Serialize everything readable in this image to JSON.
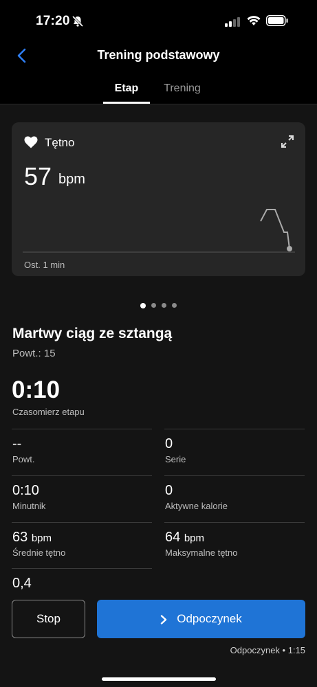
{
  "status_bar": {
    "time": "17:20",
    "icons": [
      "bell-slash-icon",
      "signal-icon",
      "wifi-icon",
      "battery-icon"
    ]
  },
  "nav": {
    "title": "Trening podstawowy",
    "back_icon": "chevron-left-icon"
  },
  "tabs": [
    {
      "label": "Etap",
      "active": true
    },
    {
      "label": "Trening",
      "active": false
    }
  ],
  "heart_rate_card": {
    "title": "Tętno",
    "value": "57",
    "unit": "bpm",
    "caption": "Ost. 1 min",
    "icon": "heart-icon",
    "expand_icon": "expand-icon"
  },
  "pager": {
    "count": 4,
    "active_index": 0
  },
  "exercise": {
    "name": "Martwy ciąg ze sztangą",
    "reps": "Powt.: 15"
  },
  "step_timer": {
    "value": "0:10",
    "label": "Czasomierz etapu"
  },
  "metrics": [
    {
      "value": "--",
      "unit": "",
      "label": "Powt."
    },
    {
      "value": "0",
      "unit": "",
      "label": "Serie"
    },
    {
      "value": "0:10",
      "unit": "",
      "label": "Minutnik"
    },
    {
      "value": "0",
      "unit": "",
      "label": "Aktywne kalorie"
    },
    {
      "value": "63",
      "unit": "bpm",
      "label": "Średnie tętno"
    },
    {
      "value": "64",
      "unit": "bpm",
      "label": "Maksymalne tętno"
    },
    {
      "value": "0,4",
      "unit": "",
      "label": ""
    }
  ],
  "actions": {
    "stop_label": "Stop",
    "rest_label": "Odpoczynek",
    "rest_caption": "Odpoczynek • 1:15"
  },
  "colors": {
    "accent": "#1f74d6",
    "background": "#141414",
    "card": "#262626"
  }
}
